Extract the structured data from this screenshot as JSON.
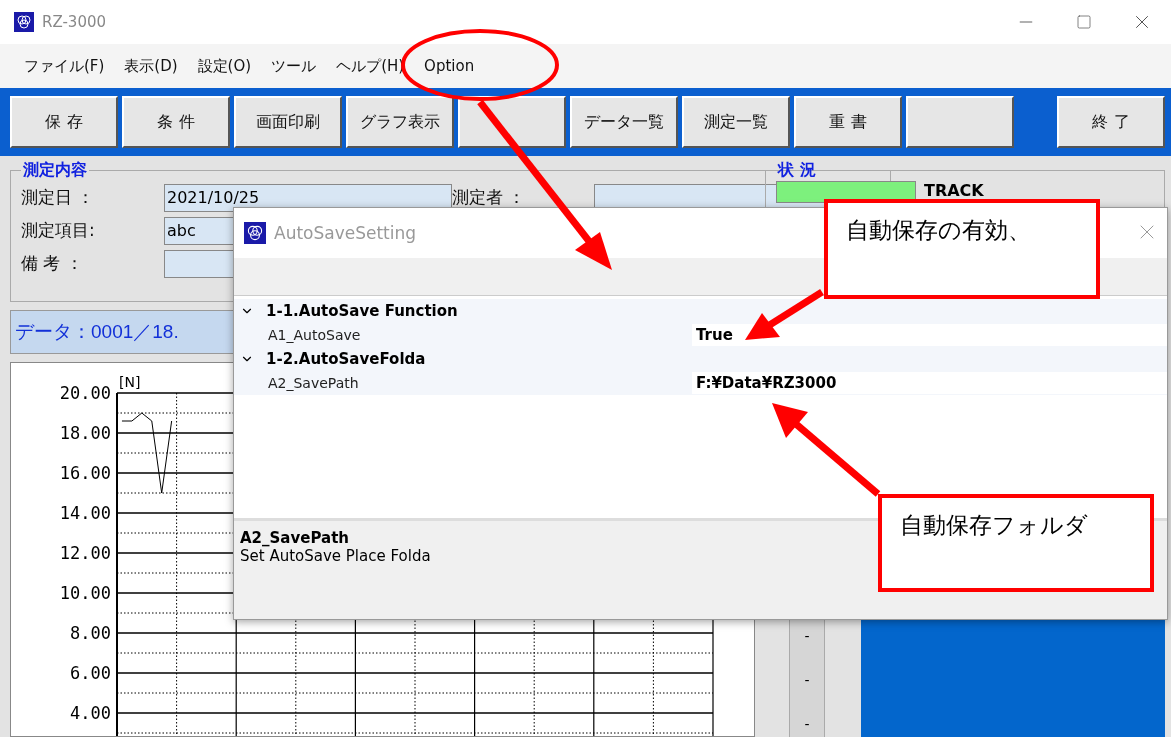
{
  "window": {
    "title": "RZ-3000"
  },
  "menu": [
    "ファイル(F)",
    "表示(D)",
    "設定(O)",
    "ツール",
    "ヘルプ(H)",
    "Option"
  ],
  "toolbar": {
    "buttons": [
      {
        "kind": "button",
        "label": "保 存"
      },
      {
        "kind": "button",
        "label": "条 件"
      },
      {
        "kind": "button",
        "label": "画面印刷"
      },
      {
        "kind": "button",
        "label": "グラフ表示"
      },
      {
        "kind": "blank"
      },
      {
        "kind": "button",
        "label": "データ一覧"
      },
      {
        "kind": "button",
        "label": "測定一覧"
      },
      {
        "kind": "button",
        "label": "重 書"
      },
      {
        "kind": "blank"
      }
    ],
    "exit_button": "終 了"
  },
  "measurement": {
    "title": "測定内容",
    "rows": [
      [
        {
          "label": "測定日 ：",
          "value": "2021/10/25"
        },
        {
          "label": "測定者 ："
        }
      ],
      [
        {
          "label": "測定項目:",
          "value": "abc"
        }
      ],
      [
        {
          "label": "備 考 ："
        }
      ]
    ]
  },
  "data_header": "データ：0001／18.",
  "chart": {
    "chart_data": {
      "type": "line",
      "ylabel": "[N]",
      "ylim": [
        3,
        20
      ],
      "yticks": [
        {
          "value": 20,
          "label": "20.00"
        },
        {
          "value": 18,
          "label": "18.00"
        },
        {
          "value": 16,
          "label": "16.00"
        },
        {
          "value": 14,
          "label": "14.00"
        },
        {
          "value": 12,
          "label": "12.00"
        },
        {
          "value": 10,
          "label": "10.00"
        },
        {
          "value": 8,
          "label": "8.00"
        },
        {
          "value": 6,
          "label": "6.00"
        },
        {
          "value": 4,
          "label": "4.00"
        }
      ],
      "grid": true,
      "categories": [
        null,
        null,
        null,
        null,
        null,
        null,
        null,
        null,
        null,
        null,
        null,
        null,
        null,
        null,
        null,
        null,
        null,
        null,
        null,
        null,
        null,
        null,
        null,
        null,
        null,
        null,
        null,
        null,
        null,
        null,
        null,
        null,
        null,
        null,
        null,
        null,
        null,
        null,
        null,
        null,
        null,
        null,
        null,
        null,
        null,
        null,
        null,
        null,
        null,
        null,
        null,
        null,
        null,
        null,
        null,
        null,
        null,
        null,
        null,
        null
      ],
      "series": [
        {
          "color": "#000000",
          "values": [
            18.6,
            18.6,
            19.0,
            18.6,
            15.0,
            18.6,
            null,
            null,
            null,
            null,
            null,
            null,
            null,
            null,
            null,
            null,
            null,
            null,
            null,
            null,
            null,
            null,
            null,
            null,
            null,
            null,
            null,
            null,
            null,
            null,
            null,
            null,
            null,
            null,
            null,
            null,
            null,
            null,
            null,
            null,
            null,
            null,
            null,
            null,
            null,
            null,
            null,
            null,
            null,
            null,
            null,
            null,
            null,
            null,
            null,
            null,
            null,
            null,
            null,
            null
          ]
        }
      ]
    }
  },
  "status": {
    "title": "状 況",
    "track_label": "TRACK",
    "dashes": [
      "-",
      "-",
      "-"
    ]
  },
  "dialog": {
    "title": "AutoSaveSetting",
    "categories": [
      {
        "name": "1-1.AutoSave Function",
        "expanded": true,
        "properties": [
          {
            "name": "A1_AutoSave",
            "value": "True"
          }
        ]
      },
      {
        "name": "1-2.AutoSaveFolda",
        "expanded": true,
        "properties": [
          {
            "name": "A2_SavePath",
            "value": "F:¥Data¥RZ3000"
          }
        ]
      }
    ],
    "description": {
      "title": "A2_SavePath",
      "text": "Set AutoSave Place Folda"
    }
  },
  "callouts": [
    "自動保存の有効、",
    "自動保存フォルダ"
  ]
}
